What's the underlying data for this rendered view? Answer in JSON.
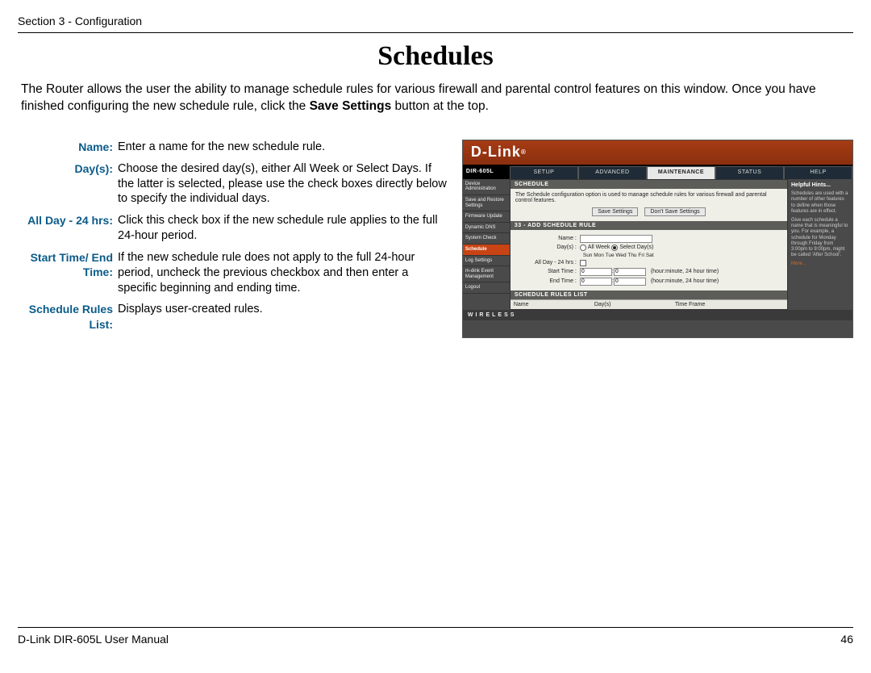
{
  "header": {
    "section": "Section 3 - Configuration"
  },
  "title": "Schedules",
  "intro": {
    "t1": "The Router allows the user the ability to manage schedule rules for various firewall and parental control features on this window. Once you have finished configuring the new schedule rule, click the ",
    "bold": "Save Settings",
    "t2": " button at the top."
  },
  "defs": [
    {
      "label": "Name:",
      "desc": "Enter a name for the new schedule rule."
    },
    {
      "label": "Day(s):",
      "desc": "Choose the desired day(s), either All Week or Select Days. If the latter is selected, please use the check boxes directly below to specify the individual days."
    },
    {
      "label": "All Day - 24 hrs:",
      "desc": "Click this check box if the new schedule rule applies to the full 24-hour period."
    },
    {
      "label": "Start Time/ End Time:",
      "desc": "If the new schedule rule does not apply to the full 24-hour period, uncheck the previous checkbox and then enter a specific beginning and ending time."
    },
    {
      "label": "Schedule Rules List:",
      "desc": "Displays user-created rules."
    }
  ],
  "router": {
    "brand": "D-Link",
    "model": "DIR-605L",
    "tabs": [
      "SETUP",
      "ADVANCED",
      "MAINTENANCE",
      "STATUS",
      "HELP"
    ],
    "active_tab": "MAINTENANCE",
    "sidebar": [
      "Device Administration",
      "Save and Restore Settings",
      "Firmware Update",
      "Dynamic DNS",
      "System Check",
      "Schedule",
      "Log Settings",
      "m-dink Event Management",
      "Logout"
    ],
    "sched_header": "SCHEDULE",
    "sched_desc": "The Schedule configuration option is used to manage schedule rules for various firewall and parental control features.",
    "save_btn": "Save Settings",
    "dont_save_btn": "Don't Save Settings",
    "add_header": "33 - ADD SCHEDULE RULE",
    "form": {
      "name_lbl": "Name :",
      "days_lbl": "Day(s) :",
      "all_week": "All Week",
      "select_days": "Select Day(s)",
      "days": [
        "Sun",
        "Mon",
        "Tue",
        "Wed",
        "Thu",
        "Fri",
        "Sat"
      ],
      "allday_lbl": "All Day - 24 hrs :",
      "start_lbl": "Start Time :",
      "end_lbl": "End Time :",
      "start_h": "0",
      "start_m": "0",
      "end_h": "0",
      "end_m": "0",
      "hint": "(hour:minute, 24 hour time)"
    },
    "list_header": "SCHEDULE RULES LIST",
    "list_cols": [
      "Name",
      "Day(s)",
      "Time Frame"
    ],
    "hints": {
      "title": "Helpful Hints...",
      "p1": "Schedules are used with a number of other features to define when those features are in effect.",
      "p2": "Give each schedule a name that is meaningful to you. For example, a schedule for Monday through Friday from 3:00pm to 9:00pm, might be called 'After School'.",
      "more": "More..."
    },
    "footer": "WIRELESS"
  },
  "footer": {
    "left": "D-Link DIR-605L User Manual",
    "right": "46"
  }
}
